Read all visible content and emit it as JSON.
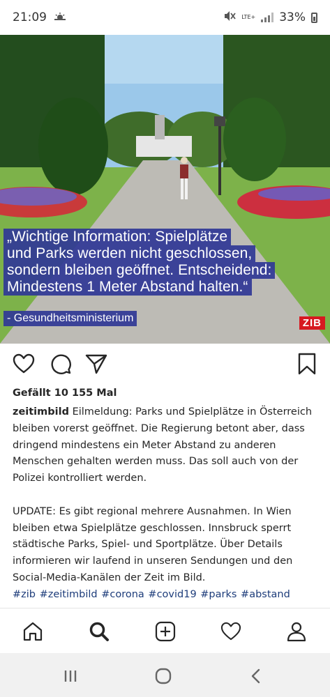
{
  "status_bar": {
    "time": "21:09",
    "network": "LTE+",
    "battery": "33%"
  },
  "post_image": {
    "quote_lines": [
      "„Wichtige Information: Spielplätze",
      "und Parks werden nicht geschlossen,",
      "sondern bleiben geöffnet. Entscheidend:",
      "Mindestens 1 Meter Abstand halten.“"
    ],
    "source": "- Gesundheitsministerium",
    "logo": "ZIB"
  },
  "likes": "Gefällt 10 155 Mal",
  "caption": {
    "username": "zeitimbild",
    "text": "Eilmeldung: Parks und Spielplätze in Österreich bleiben vorerst geöffnet. Die Regierung betont aber, dass dringend mindestens ein Meter Abstand zu anderen Menschen gehalten werden muss. Das soll auch von der Polizei kontrolliert werden.",
    "update": "UPDATE: Es gibt regional mehrere Ausnahmen. In Wien bleiben etwa Spielplätze geschlossen. Innsbruck sperrt städtische Parks, Spiel- und Sportplätze. Über Details informieren wir laufend in unseren Sendungen und den Social-Media-Kanälen der Zeit im Bild.",
    "hashtags": "#zib #zeitimbild #corona #covid19 #parks #abstand"
  },
  "icons": {
    "like": "heart-icon",
    "comment": "comment-icon",
    "share": "send-icon",
    "save": "bookmark-icon",
    "nav": [
      "home-icon",
      "search-icon",
      "add-post-icon",
      "activity-heart-icon",
      "profile-icon"
    ],
    "system": [
      "recent-apps-icon",
      "home-circle-icon",
      "back-icon"
    ]
  },
  "colors": {
    "quote_background": "#303996",
    "logo_red": "#d71920",
    "hashtag": "#1d3c7a"
  }
}
